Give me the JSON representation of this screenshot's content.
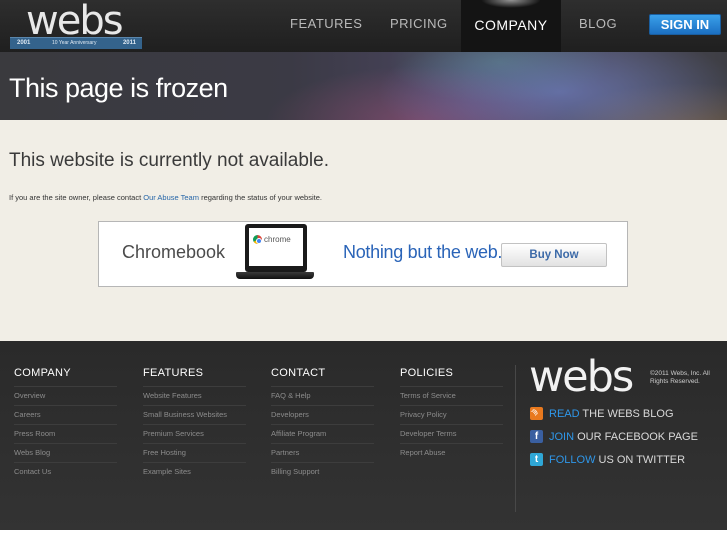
{
  "header": {
    "logo": {
      "text": "webs",
      "ribbon_left": "2001",
      "ribbon_middle": "10 Year Anniversary",
      "ribbon_right": "2011"
    },
    "nav": {
      "features": "FEATURES",
      "pricing": "PRICING",
      "company": "COMPANY",
      "blog": "BLOG"
    },
    "sign_in": "SIGN IN",
    "active_tab": "COMPANY"
  },
  "banner": {
    "title": "This page is frozen"
  },
  "main": {
    "headline": "This website is currently not available.",
    "notice_prefix": "If you are the site owner, please contact ",
    "notice_link": "Our Abuse Team",
    "notice_suffix": " regarding the status of your website."
  },
  "ad": {
    "product": "Chromebook",
    "screen_brand": "chrome",
    "slogan": "Nothing but the web.",
    "button": "Buy Now"
  },
  "footer": {
    "columns": [
      {
        "title": "COMPANY",
        "items": [
          "Overview",
          "Careers",
          "Press Room",
          "Webs Blog",
          "Contact Us"
        ]
      },
      {
        "title": "FEATURES",
        "items": [
          "Website Features",
          "Small Business Websites",
          "Premium Services",
          "Free Hosting",
          "Example Sites"
        ]
      },
      {
        "title": "CONTACT",
        "items": [
          "FAQ & Help",
          "Developers",
          "Affiliate Program",
          "Partners",
          "Billing Support"
        ]
      },
      {
        "title": "POLICIES",
        "items": [
          "Terms of Service",
          "Privacy Policy",
          "Developer Terms",
          "Report Abuse"
        ]
      }
    ],
    "logo": "webs",
    "copyright": "©2011 Webs, Inc. All Rights Reserved.",
    "social": [
      {
        "highlight": "READ",
        "rest": "THE WEBS BLOG",
        "icon": "rss-icon"
      },
      {
        "highlight": "JOIN",
        "rest": "OUR FACEBOOK PAGE",
        "icon": "facebook-icon",
        "glyph": "f"
      },
      {
        "highlight": "FOLLOW",
        "rest": "US ON TWITTER",
        "icon": "twitter-icon",
        "glyph": "t"
      }
    ]
  },
  "colors": {
    "accent_blue": "#2f97e9",
    "sign_in_blue": "#1b6fc2",
    "link_blue": "#2766a8",
    "content_bg": "#f1eee6",
    "footer_bg": "#2e2e2e"
  }
}
